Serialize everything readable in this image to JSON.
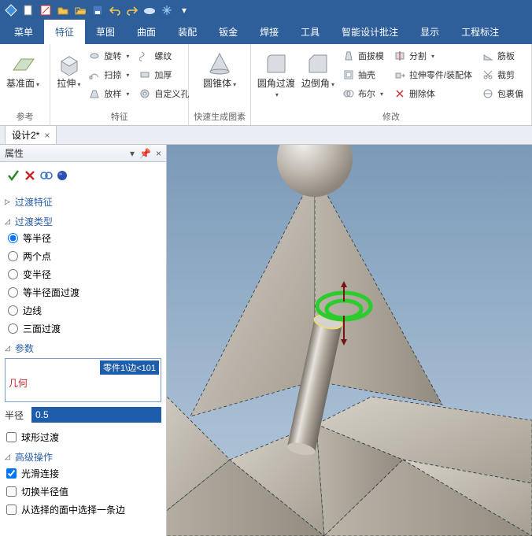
{
  "qat": {
    "icons": [
      "zw-logo",
      "new",
      "sketch",
      "open",
      "folder",
      "save",
      "undo",
      "redo",
      "cloud",
      "snow",
      "dropdown"
    ]
  },
  "tabs": {
    "items": [
      "菜单",
      "特征",
      "草图",
      "曲面",
      "装配",
      "钣金",
      "焊接",
      "工具",
      "智能设计批注",
      "显示",
      "工程标注"
    ],
    "active_index": 1
  },
  "ribbon": {
    "groups": [
      {
        "label": "参考",
        "big": [
          {
            "icon": "plane",
            "label": "基准面",
            "drop": true
          }
        ]
      },
      {
        "label": "特征",
        "big": [
          {
            "icon": "extrude",
            "label": "拉伸",
            "drop": true
          }
        ],
        "smallcols": [
          [
            {
              "icon": "revolve",
              "label": "旋转",
              "drop": true
            },
            {
              "icon": "sweep",
              "label": "扫掠",
              "drop": true
            },
            {
              "icon": "loft",
              "label": "放样",
              "drop": true
            }
          ],
          [
            {
              "icon": "thread",
              "label": "螺纹"
            },
            {
              "icon": "thicken",
              "label": "加厚"
            },
            {
              "icon": "customhole",
              "label": "自定义孔"
            }
          ]
        ]
      },
      {
        "label": "快速生成图素",
        "big": [
          {
            "icon": "cone",
            "label": "圆锥体",
            "drop": true
          }
        ]
      },
      {
        "label": "修改",
        "big": [
          {
            "icon": "fillet",
            "label": "圆角过渡",
            "drop": true
          },
          {
            "icon": "chamfer",
            "label": "边倒角",
            "drop": true
          }
        ],
        "smallcols": [
          [
            {
              "icon": "draft",
              "label": "面拔模"
            },
            {
              "icon": "shell",
              "label": "抽壳"
            },
            {
              "icon": "boolean",
              "label": "布尔",
              "drop": true
            }
          ],
          [
            {
              "icon": "split",
              "label": "分割",
              "drop": true
            },
            {
              "icon": "extract",
              "label": "拉伸零件/装配体"
            },
            {
              "icon": "delete",
              "label": "删除体"
            }
          ],
          [
            {
              "icon": "rib",
              "label": "筋板"
            },
            {
              "icon": "cut",
              "label": "裁剪"
            },
            {
              "icon": "wrap",
              "label": "包裹偏"
            }
          ]
        ]
      }
    ]
  },
  "doctab": {
    "title": "设计2*"
  },
  "panel": {
    "title": "属性",
    "feature_name": "过渡特征",
    "type_group": {
      "title": "过渡类型",
      "options": [
        "等半径",
        "两个点",
        "变半径",
        "等半径面过渡",
        "边线",
        "三面过渡"
      ],
      "selected_index": 0
    },
    "params": {
      "title": "参数",
      "geo_label": "几何",
      "geo_selection": "零件1\\边<101",
      "radius_label": "半径",
      "radius_value": "0.5",
      "sphere_checkbox": "球形过渡"
    },
    "advanced": {
      "title": "高级操作",
      "checks": [
        {
          "label": "光滑连接",
          "checked": true
        },
        {
          "label": "切换半径值",
          "checked": false
        },
        {
          "label": "从选择的面中选择一条边",
          "checked": false
        }
      ]
    }
  },
  "colors": {
    "ribbon_blue": "#2e5f9a",
    "sel_blue": "#1e5daa"
  }
}
